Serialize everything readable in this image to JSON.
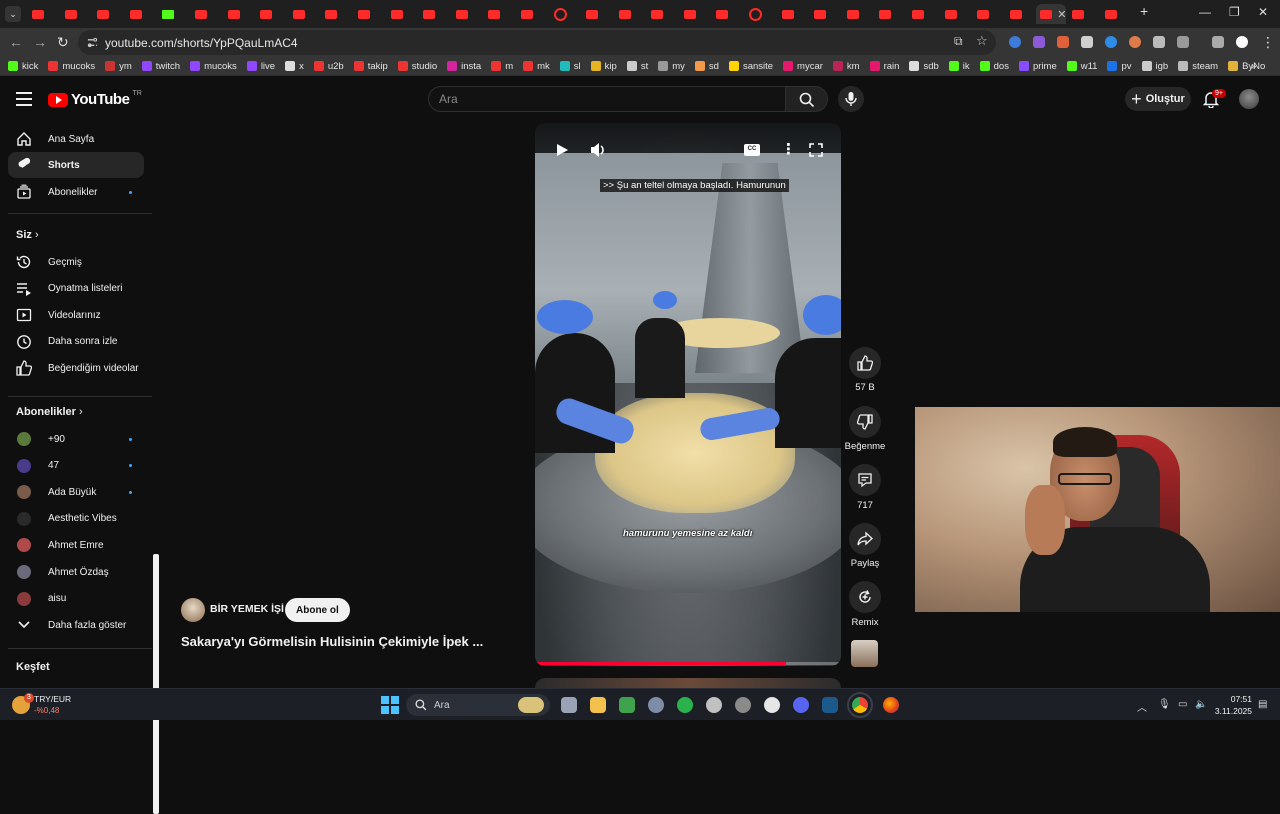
{
  "browser": {
    "url": "youtube.com/shorts/YpPQauLmAC4",
    "bookmarks": [
      "kick",
      "mucoks",
      "ym",
      "twitch",
      "mucoks",
      "live",
      "x",
      "u2b",
      "takip",
      "studio",
      "insta",
      "m",
      "mk",
      "sl",
      "kip",
      "st",
      "my",
      "sd",
      "sansite",
      "mycar",
      "km",
      "rain",
      "sdb",
      "ik",
      "dos",
      "prime",
      "w11",
      "pv",
      "igb",
      "steam",
      "ByNo"
    ]
  },
  "yt": {
    "logo_text": "YouTube",
    "region": "TR",
    "search_placeholder": "Ara",
    "create_label": "Oluştur",
    "notif_badge": "9+"
  },
  "sidebar": {
    "main": [
      {
        "label": "Ana Sayfa",
        "icon": "home-icon"
      },
      {
        "label": "Shorts",
        "icon": "shorts-icon",
        "active": true
      },
      {
        "label": "Abonelikler",
        "icon": "subscriptions-icon"
      }
    ],
    "you_heading": "Siz",
    "you": [
      {
        "label": "Geçmiş",
        "icon": "history-icon"
      },
      {
        "label": "Oynatma listeleri",
        "icon": "playlists-icon"
      },
      {
        "label": "Videolarınız",
        "icon": "your-videos-icon"
      },
      {
        "label": "Daha sonra izle",
        "icon": "watch-later-icon"
      },
      {
        "label": "Beğendiğim videolar",
        "icon": "liked-videos-icon"
      }
    ],
    "subs_heading": "Abonelikler",
    "subs": [
      {
        "label": "+90",
        "color": "#5a7a3a"
      },
      {
        "label": "47",
        "color": "#4a3a8a"
      },
      {
        "label": "Ada Büyük",
        "color": "#7a5a4a"
      },
      {
        "label": "Aesthetic Vibes",
        "color": "#2a2a2a"
      },
      {
        "label": "Ahmet Emre",
        "color": "#b04a4a"
      },
      {
        "label": "Ahmet Özdaş",
        "color": "#6a6a7a"
      },
      {
        "label": "aisu",
        "color": "#8a3a3a"
      }
    ],
    "show_more": "Daha fazla göster",
    "explore_heading": "Keşfet"
  },
  "short": {
    "subtitle_top": ">> Şu an teltel olmaya başladı. Hamurunun",
    "subtitle_bottom": "hamurunu yemesine az kaldı",
    "progress": 0.82,
    "channel": "BİR YEMEK İŞİ",
    "subscribe_label": "Abone ol",
    "title": "Sakarya'yı Görmelisin Hulisinin Çekimiyle İpek ..."
  },
  "actions": {
    "likes": "57 B",
    "dislike": "Beğenme",
    "comments": "717",
    "share": "Paylaş",
    "remix": "Remix"
  },
  "taskbar": {
    "ticker": "TRY/EUR",
    "ticker_change": "-%0,48",
    "weather_badge": "3",
    "search": "Ara",
    "time": "07:51",
    "date": "3.11.2025"
  }
}
